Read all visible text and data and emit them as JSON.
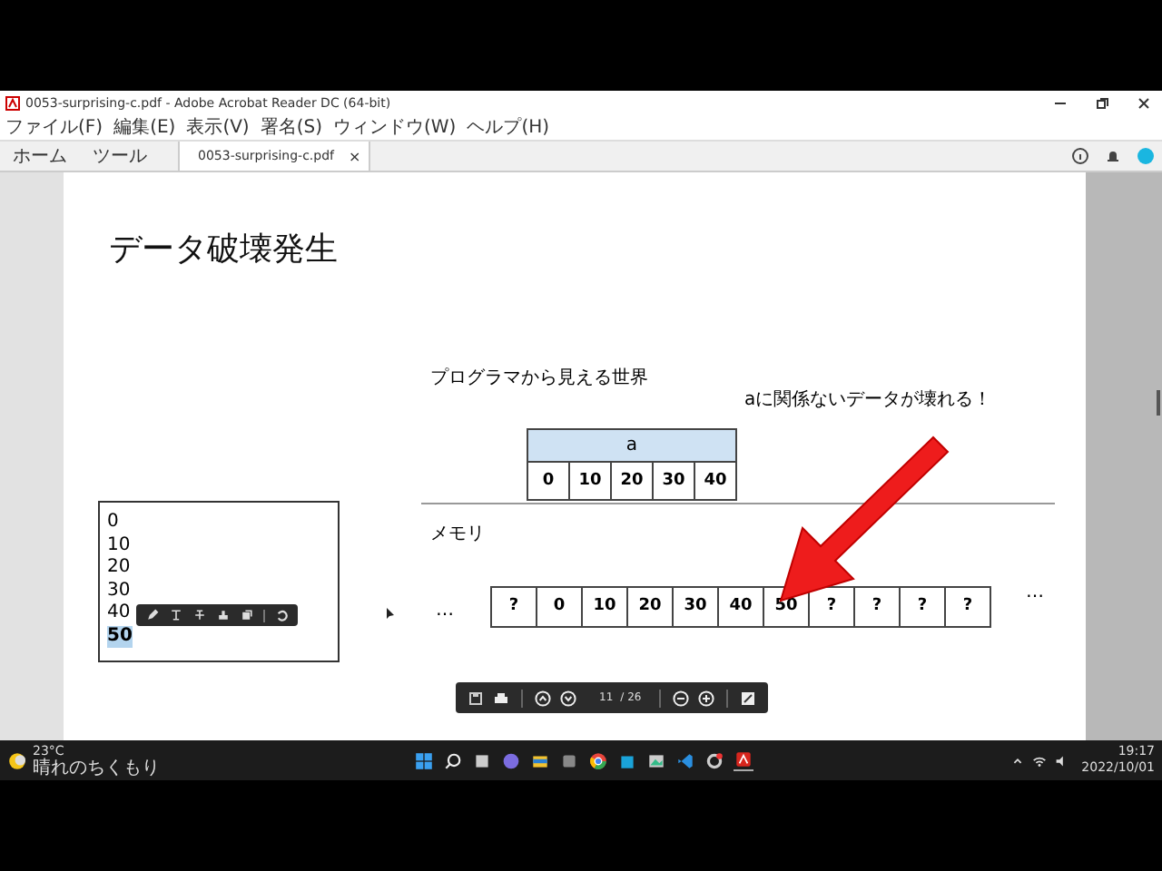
{
  "window": {
    "title": "0053-surprising-c.pdf - Adobe Acrobat Reader DC (64-bit)"
  },
  "menu": [
    "ファイル(F)",
    "編集(E)",
    "表示(V)",
    "署名(S)",
    "ウィンドウ(W)",
    "ヘルプ(H)"
  ],
  "tabs": [
    {
      "label": "ホーム",
      "selected": false
    },
    {
      "label": "ツール",
      "selected": false
    },
    {
      "label": "0053-surprising-c.pdf",
      "selected": true,
      "close": "×"
    }
  ],
  "slide": {
    "title": "データ破壊発生",
    "programmer_label": "プログラマから見える世界",
    "callout": "aに関係ないデータが壊れる！",
    "array": {
      "name": "a",
      "values": [
        "0",
        "10",
        "20",
        "30",
        "40"
      ]
    },
    "memory_label": "メモリ",
    "ellipsis_left": "…",
    "ellipsis_right": "…",
    "memory_cells": [
      "?",
      "0",
      "10",
      "20",
      "30",
      "40",
      "50",
      "?",
      "?",
      "?",
      "?"
    ]
  },
  "text_box": {
    "lines": [
      {
        "text": "0",
        "selected": false
      },
      {
        "text": "10",
        "selected": false
      },
      {
        "text": "20",
        "selected": false
      },
      {
        "text": "30",
        "selected": false
      },
      {
        "text": "40",
        "selected": false
      },
      {
        "text": "50",
        "selected": true
      }
    ]
  },
  "page_toolbar": {
    "page": "11",
    "total": "/ 26"
  },
  "taskbar": {
    "temperature": "23°C",
    "weather": "晴れのちくもり",
    "time": "19:17",
    "date": "2022/10/01"
  }
}
